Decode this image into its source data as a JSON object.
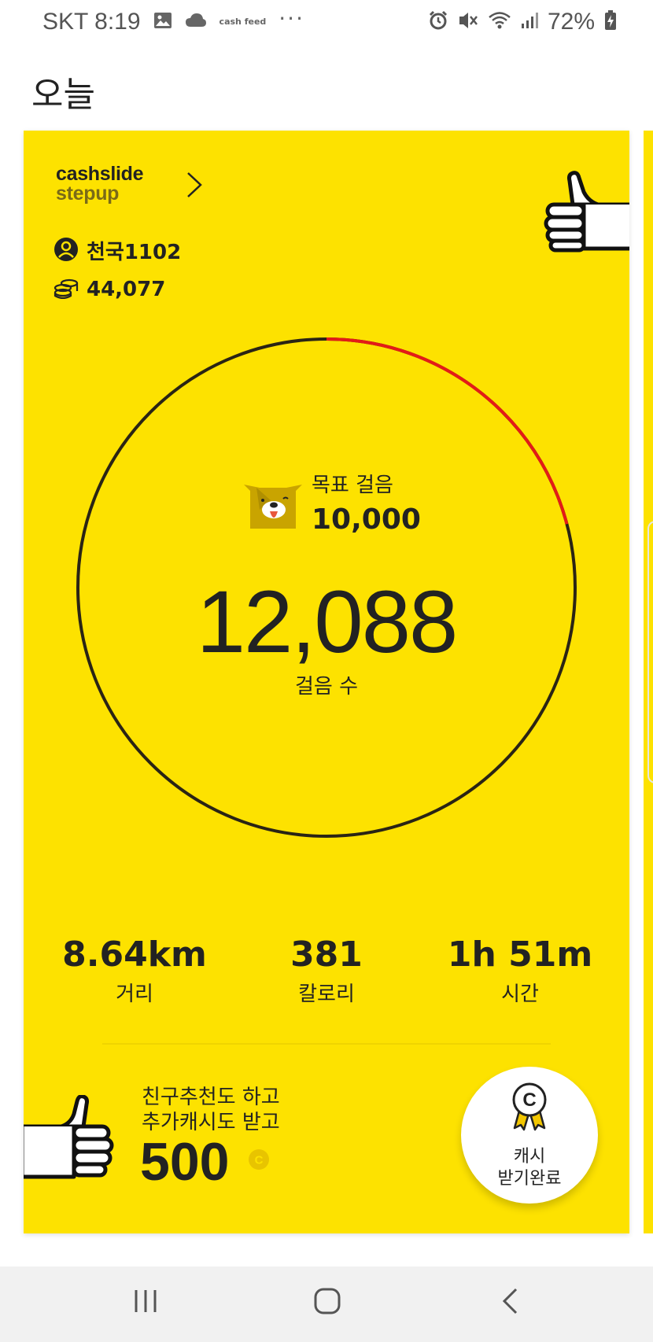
{
  "status_bar": {
    "carrier": "SKT",
    "time": "8:19",
    "cashfeed_label": "cash feed",
    "battery": "72%",
    "icons": [
      "image-icon",
      "cloud-icon",
      "cashfeed-icon",
      "more-dots-icon",
      "alarm-icon",
      "vibrate-mute-icon",
      "wifi-icon",
      "signal-icon",
      "battery-icon"
    ]
  },
  "page": {
    "title": "오늘"
  },
  "card": {
    "logo_line1": "cashslide",
    "logo_line2": "stepup",
    "user": {
      "name": "천국1102"
    },
    "coins": {
      "value": "44,077"
    },
    "goal": {
      "label": "목표 걸음",
      "value": "10,000"
    },
    "steps": {
      "value": "12,088",
      "label": "걸음 수"
    },
    "progress": {
      "steps": 12088,
      "goal": 10000,
      "over_goal_fraction": 0.2088
    },
    "stats": [
      {
        "value": "8.64km",
        "label": "거리"
      },
      {
        "value": "381",
        "label": "칼로리"
      },
      {
        "value": "1h 51m",
        "label": "시간"
      }
    ],
    "invite": {
      "line1": "친구추천도 하고",
      "line2": "추가캐시도 받고",
      "amount": "500",
      "coin_symbol": "C"
    },
    "cash_button": {
      "line1": "캐시",
      "line2": "받기완료",
      "medal_symbol": "C"
    }
  },
  "colors": {
    "card_yellow": "#fde200",
    "ring_dark": "#2a2414",
    "ring_red": "#e41b17",
    "nav_bg": "#f1f1f1"
  },
  "nav": {
    "items": [
      "recent-apps-icon",
      "home-icon",
      "back-icon"
    ]
  }
}
